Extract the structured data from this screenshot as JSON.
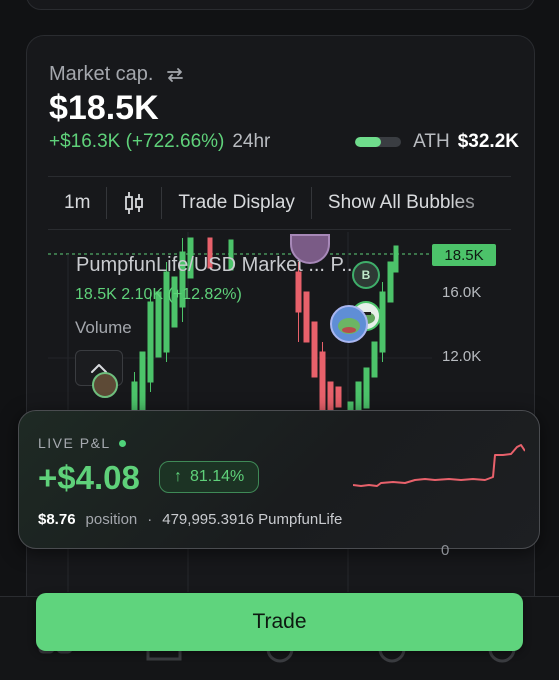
{
  "market": {
    "label": "Market cap.",
    "value": "$18.5K",
    "change": "+$16.3K (+722.66%)",
    "period": "24hr",
    "ath_label": "ATH",
    "ath_value": "$32.2K",
    "ath_progress": 0.57
  },
  "toolbar": {
    "interval": "1m",
    "trade_display": "Trade Display",
    "show_bubbles": "Show All Bubbles"
  },
  "chart": {
    "title": "PumpfunLife/USD Market ... P...",
    "stats": "18.5K  2.10K (+12.82%)",
    "volume_label": "Volume",
    "current_price": "18.5K",
    "axis_labels": [
      "16.0K",
      "12.0K"
    ],
    "zero_label": "0",
    "bubble_b": "B"
  },
  "pnl": {
    "label": "LIVE P&L",
    "value": "+$4.08",
    "pct_arrow": "↑",
    "pct": "81.14%",
    "position_value": "$8.76",
    "position_label": "position",
    "separator": "·",
    "tokens": "479,995.3916 PumpfunLife"
  },
  "trade_button": "Trade",
  "colors": {
    "green": "#5fd17a",
    "red": "#e8616b",
    "background": "#111214"
  }
}
